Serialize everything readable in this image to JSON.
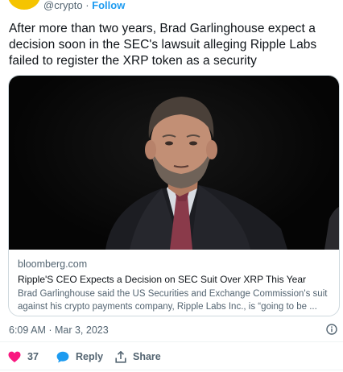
{
  "author": {
    "handle": "@crypto",
    "separator": " · ",
    "follow_label": "Follow"
  },
  "tweet": {
    "text": "After more than two years, Brad Garlinghouse expect a decision soon in the SEC's lawsuit alleging Ripple Labs failed to register the XRP token as a security",
    "timestamp": "6:09 AM · Mar 3, 2023"
  },
  "card": {
    "domain": "bloomberg.com",
    "title": "Ripple'S CEO Expects a Decision on SEC Suit Over XRP This Year",
    "description": "Brad Garlinghouse said the US Securities and Exchange Commission's suit against his crypto payments company, Ripple Labs Inc., is “going to be ..."
  },
  "actions": {
    "like_count": "37",
    "reply_label": "Reply",
    "share_label": "Share"
  },
  "colors": {
    "accent": "#1d9bf0",
    "like": "#f91880",
    "text_secondary": "#536471",
    "avatar": "#f5c400"
  },
  "icons": [
    "info-icon",
    "heart-icon",
    "reply-icon",
    "share-icon"
  ]
}
